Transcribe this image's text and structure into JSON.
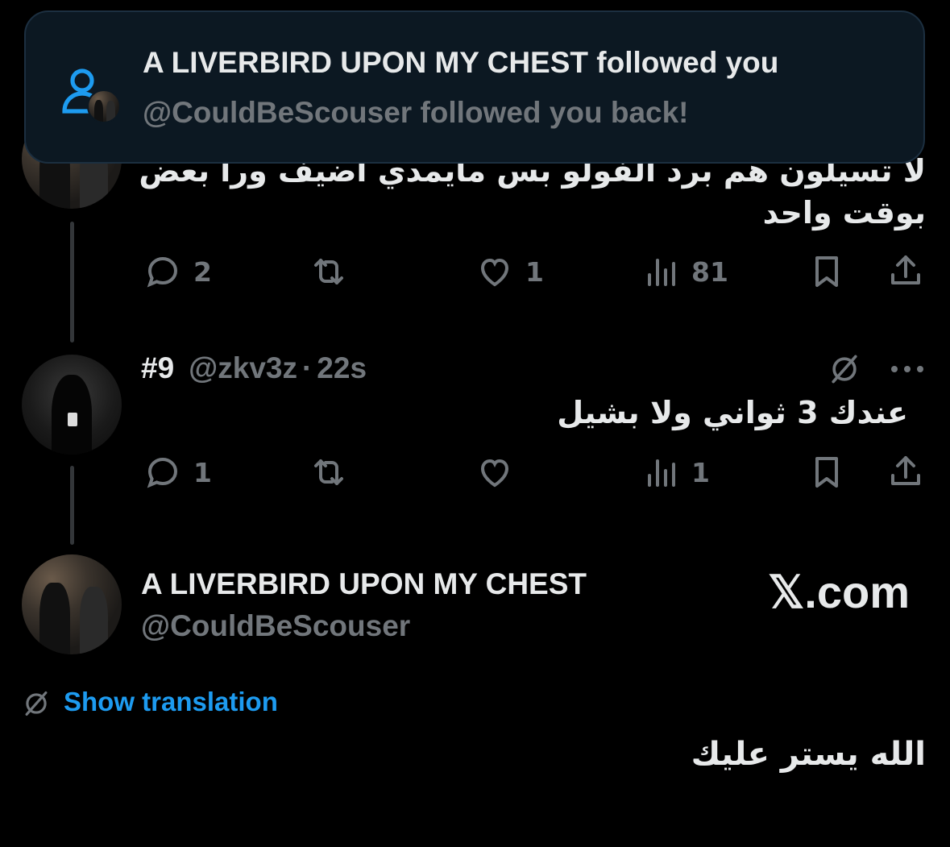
{
  "notification": {
    "title": "A LIVERBIRD UPON MY CHEST followed you",
    "subtitle": "@CouldBeScouser followed you back!",
    "icon": "person-icon",
    "accent": "#1d9bf0"
  },
  "tweet1": {
    "text_line1": "لا تسيلون هم برد الفولو بس مايمدي اضيف ورا بعض",
    "text_line2": "بوقت واحد",
    "replies": "2",
    "retweets": "",
    "likes": "1",
    "views": "81"
  },
  "tweet2": {
    "name": "#9",
    "handle": "@zkv3z",
    "separator": "·",
    "time": "22s",
    "text": "عندك 3 ثواني ولا بشيل",
    "replies": "1",
    "retweets": "",
    "likes": "",
    "views": "1"
  },
  "profile": {
    "name": "A LIVERBIRD UPON MY CHEST",
    "handle": "@CouldBeScouser",
    "watermark": "𝕏.com",
    "show_translation": "Show translation",
    "bio": "الله يستر عليك"
  },
  "colors": {
    "background": "#000000",
    "text": "#e7e9ea",
    "muted": "#71767b",
    "link": "#1d9bf0"
  }
}
